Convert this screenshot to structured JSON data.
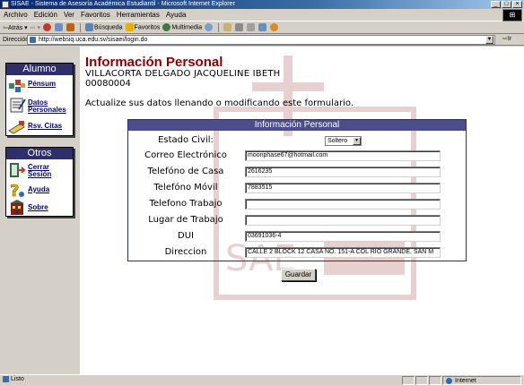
{
  "window": {
    "title": "SISAE - Sistema de Asesoría Académica Estudiantil - Microsoft Internet Explorer",
    "controls": [
      "_",
      "□",
      "×"
    ]
  },
  "menubar": {
    "items": [
      "Archivo",
      "Edición",
      "Ver",
      "Favoritos",
      "Herramientas",
      "Ayuda"
    ]
  },
  "toolbar": {
    "back": "Atrás",
    "search": "Búsqueda",
    "favorites": "Favoritos",
    "multimedia": "Multimedia"
  },
  "address": {
    "label": "Dirección",
    "url": "http://websiq.uca.edu.sv/sisaei/login.do",
    "go": "Ir"
  },
  "sidebar": {
    "alumno_title": "Alumno",
    "alumno_items": [
      {
        "label": "Pénsum"
      },
      {
        "label": "Datos Personales"
      },
      {
        "label": "Rsv. Citas"
      }
    ],
    "otros_title": "Otros",
    "otros_items": [
      {
        "label": "Cerrar Sesión"
      },
      {
        "label": "Ayuda"
      },
      {
        "label": "Sobre"
      }
    ]
  },
  "main": {
    "title": "Información Personal",
    "student_name": "VILLACORTA DELGADO JACQUELINE IBETH",
    "student_id": "00080004",
    "instructions": "Actualize sus datos llenando o modificando este formulario.",
    "form": {
      "header": "Información Personal",
      "fields": [
        {
          "label": "Estado Civil:",
          "value": "Soltero"
        },
        {
          "label": "Correo Electrónico",
          "value": "moonphase67@hotmail.com"
        },
        {
          "label": "Telefóno de Casa",
          "value": "2616235"
        },
        {
          "label": "Telefóno Móvil",
          "value": "7883515"
        },
        {
          "label": "Telefono Trabajo",
          "value": ""
        },
        {
          "label": "Lugar de Trabajo",
          "value": ""
        },
        {
          "label": "DUI",
          "value": "03691036-4"
        },
        {
          "label": "Direccion",
          "value": "CALLE 2 BLOCK 12 CASA NO. 151-A COL RIO GRANDE, SAN M"
        }
      ],
      "submit_label": "Guardar"
    }
  },
  "statusbar": {
    "status": "Listo",
    "zone": "Internet"
  }
}
